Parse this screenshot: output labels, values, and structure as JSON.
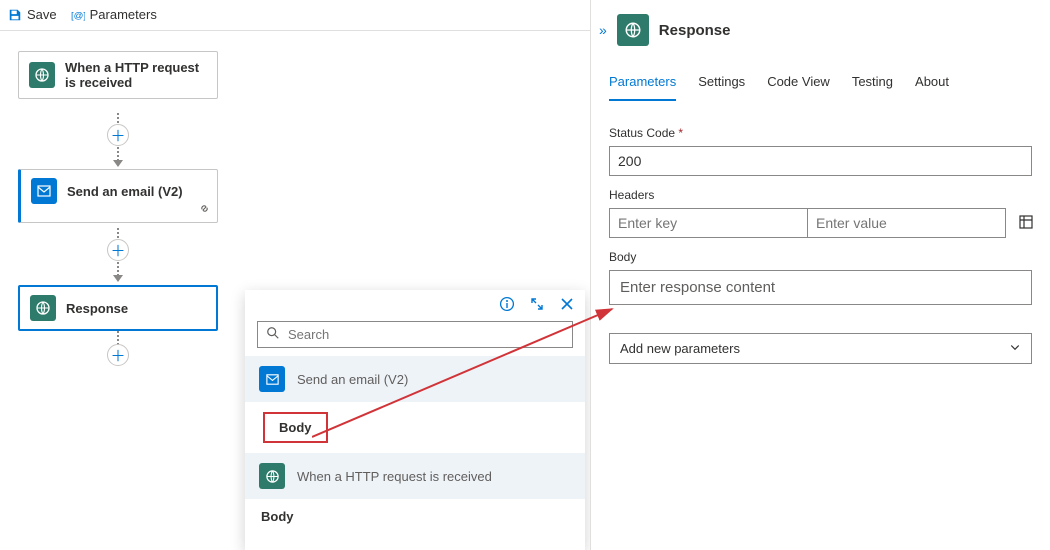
{
  "toolbar": {
    "save": "Save",
    "parameters": "Parameters"
  },
  "nodes": {
    "n1": "When a HTTP request is received",
    "n2": "Send an email (V2)",
    "n3": "Response"
  },
  "picker": {
    "search_placeholder": "Search",
    "groups": {
      "g1": "Send an email (V2)",
      "g1_body": "Body",
      "g2": "When a HTTP request is received",
      "g2_body": "Body"
    }
  },
  "details": {
    "title": "Response",
    "tabs": {
      "parameters": "Parameters",
      "settings": "Settings",
      "codeview": "Code View",
      "testing": "Testing",
      "about": "About"
    },
    "status_label": "Status Code",
    "status_value": "200",
    "headers_label": "Headers",
    "headers_key_ph": "Enter key",
    "headers_val_ph": "Enter value",
    "body_label": "Body",
    "body_ph": "Enter response content",
    "add_new": "Add new parameters"
  }
}
